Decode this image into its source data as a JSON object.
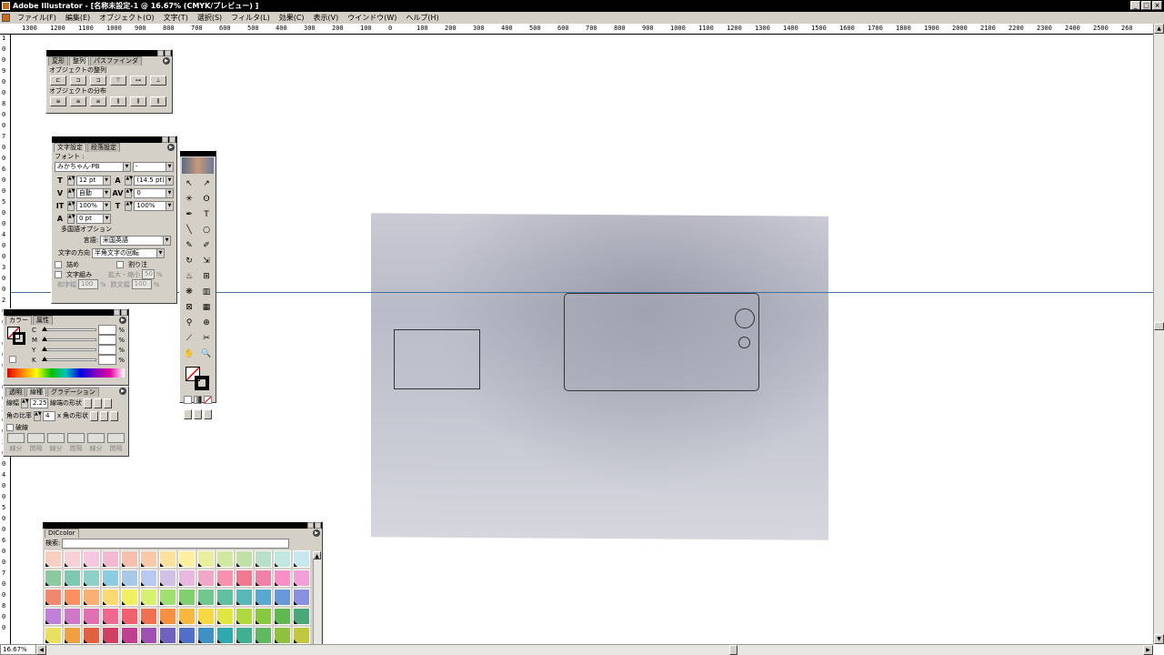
{
  "window": {
    "title": "Adobe Illustrator - [名称未設定-1 @ 16.67% (CMYK/プレビュー) ]",
    "controls": [
      "_",
      "□",
      "×"
    ]
  },
  "menu": [
    "ファイル(F)",
    "編集(E)",
    "オブジェクト(O)",
    "文字(T)",
    "選択(S)",
    "フィルタ(L)",
    "効果(C)",
    "表示(V)",
    "ウインドウ(W)",
    "ヘルプ(H)"
  ],
  "ruler": {
    "h_labels": [
      "1300",
      "1200",
      "1100",
      "1000",
      "900",
      "800",
      "700",
      "600",
      "500",
      "400",
      "300",
      "200",
      "100",
      "0",
      "100",
      "200",
      "300",
      "400",
      "500",
      "600",
      "700",
      "800",
      "900",
      "1000",
      "1100",
      "1200",
      "1300",
      "1400",
      "1500",
      "1600",
      "1700",
      "1800",
      "1900",
      "2000",
      "2100",
      "2200",
      "2300",
      "2400",
      "2500",
      "260"
    ],
    "v_labels": [
      "1",
      "0",
      "0",
      "9",
      "0",
      "0",
      "8",
      "0",
      "0",
      "7",
      "0",
      "0",
      "6",
      "0",
      "0",
      "5",
      "0",
      "0",
      "4",
      "0",
      "0",
      "3",
      "0",
      "0",
      "2",
      "0",
      "0",
      "1",
      "0",
      "0",
      "0",
      "1",
      "0",
      "0",
      "2",
      "0",
      "0",
      "3",
      "0",
      "0",
      "4",
      "0",
      "0",
      "5",
      "0",
      "0",
      "6",
      "0",
      "0",
      "7",
      "0",
      "0",
      "8",
      "0",
      "0"
    ]
  },
  "status": {
    "zoom": "16.67%"
  },
  "align_panel": {
    "tabs": [
      "変形",
      "整列",
      "パスファインダ"
    ],
    "section_align": "オブジェクトの整列",
    "section_distribute": "オブジェクトの分布"
  },
  "char_panel": {
    "tabs": [
      "文字設定",
      "段落設定"
    ],
    "font_label": "フォント :",
    "font_value": "みかちゃん-PB",
    "style_value": "-",
    "size": "12 pt",
    "leading": "(14.5 pt)",
    "tracking_mode": "自動",
    "kerning": "0",
    "v_scale": "100%",
    "h_scale": "100%",
    "baseline": "0 pt",
    "multilang_title": "多国語オプション",
    "lang_label": "言語:",
    "lang_value": "米国英語",
    "direction_label": "文字の方向",
    "direction_value": "半角文字の回転",
    "tsume": "詰め",
    "warichu": "割り注",
    "mojigumi": "文字組み",
    "scale_label": "拡大・縮小",
    "scale_value": "50",
    "pct": "%",
    "moji_haba": "和字幅",
    "moji_haba_val": "100",
    "oushoku": "欧文幅",
    "oushoku_val": "100"
  },
  "color_panel": {
    "tabs": [
      "カラー",
      "属性"
    ],
    "channels": [
      "C",
      "M",
      "Y",
      "K"
    ],
    "pct": "%"
  },
  "stroke_panel": {
    "tabs": [
      "透明",
      "線種",
      "グラデーション"
    ],
    "width_label": "線幅",
    "width_value": "2.25",
    "cap_label": "線端の形状",
    "ratio_label": "角の比率",
    "ratio_value": "4",
    "x": "x",
    "join_label": "角の形状",
    "dashed_label": "破線",
    "dash_labels": [
      "線分",
      "間隔",
      "線分",
      "間隔",
      "線分",
      "間隔"
    ]
  },
  "swatch_panel": {
    "title": "DICcolor",
    "search_label": "検索:",
    "colors": [
      [
        "#f6cfc0",
        "#f8d0d8",
        "#f6c8e0",
        "#f4b8d0",
        "#f5c0b0",
        "#f8c8a8",
        "#fbe0a0",
        "#fff0a0",
        "#e8f0a0",
        "#d0e8a0",
        "#c0e0a8",
        "#b8e0c8",
        "#c0e8e0",
        "#c8e8f0"
      ],
      [
        "#8cc8a0",
        "#7cc8b0",
        "#8cd0c8",
        "#8ccce0",
        "#a8c8e8",
        "#b8c8f0",
        "#d0c0e8",
        "#e8b8e0",
        "#f0a8c8",
        "#f890b0",
        "#f07890",
        "#f080a8",
        "#f890c8",
        "#f4a0d8"
      ],
      [
        "#f08870",
        "#f89060",
        "#f8b070",
        "#fcd870",
        "#f0f060",
        "#d8f070",
        "#a0e070",
        "#80d070",
        "#70c890",
        "#60c0a0",
        "#58b8b8",
        "#58a8d0",
        "#6898d8",
        "#8890e0"
      ],
      [
        "#c080d8",
        "#d078c8",
        "#e070b0",
        "#f06890",
        "#f06070",
        "#f07050",
        "#f89040",
        "#f8b840",
        "#f8d840",
        "#e0e840",
        "#b0d840",
        "#88c840",
        "#60b850",
        "#48a878"
      ],
      [
        "#e8e060",
        "#f0a040",
        "#e06040",
        "#d04060",
        "#c04090",
        "#a050b0",
        "#7060c0",
        "#5070c8",
        "#4090c8",
        "#30a8b0",
        "#40b090",
        "#60b860",
        "#90c040",
        "#c0c840"
      ],
      [
        "#a868a8",
        "#c86898",
        "#e06880",
        "#f07060",
        "#f89050",
        "#f8b050",
        "#f0d050",
        "#c8d850",
        "#98c850",
        "#70b860",
        "#58a880",
        "#5098a8",
        "#5888c0",
        "#6878c0"
      ]
    ]
  }
}
